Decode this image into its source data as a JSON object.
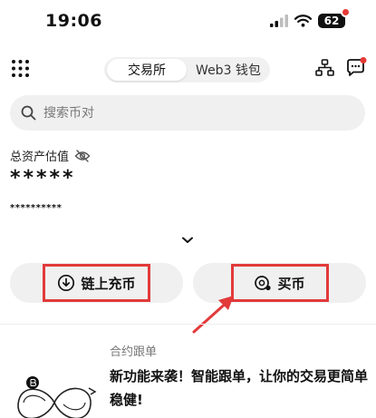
{
  "status_bar": {
    "time": "19:06",
    "battery": "62"
  },
  "top_nav": {
    "tabs": [
      {
        "label": "交易所",
        "active": true
      },
      {
        "label": "Web3 钱包",
        "active": false
      }
    ]
  },
  "search": {
    "placeholder": "搜索币对"
  },
  "assets": {
    "label": "总资产估值",
    "value": "*****",
    "sub_value": "**********"
  },
  "actions": {
    "deposit_label": "链上充币",
    "buy_label": "买币"
  },
  "promo": {
    "tag": "合约跟单",
    "title": "新功能来袭！智能跟单，让你的交易更简单稳健!"
  },
  "colors": {
    "highlight": "#e23a3a",
    "notification": "#e53935",
    "surface": "#f0f0f0"
  }
}
